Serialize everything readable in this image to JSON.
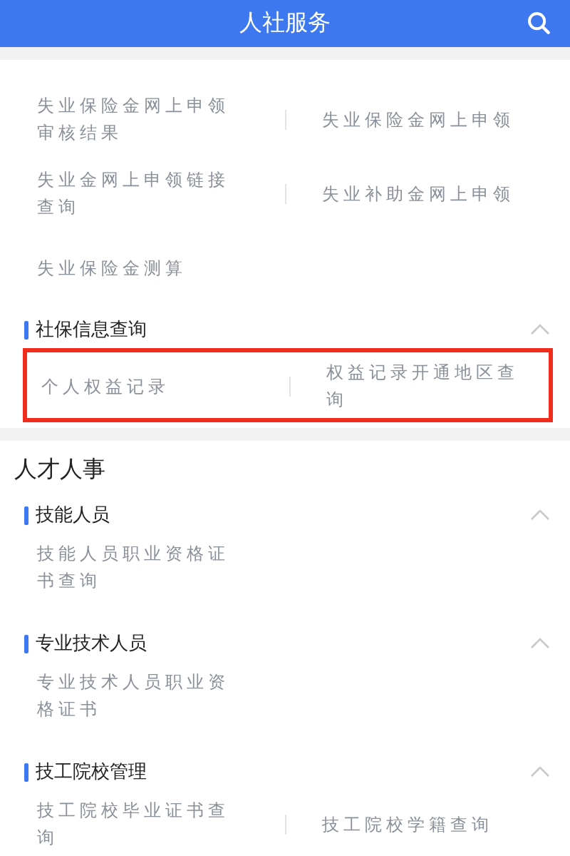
{
  "header": {
    "title": "人社服务"
  },
  "lead_items": [
    "失业保险金网上申领审核结果",
    "失业保险金网上申领",
    "失业金网上申领链接查询",
    "失业补助金网上申领",
    "失业保险金测算"
  ],
  "lead_sections": [
    {
      "title": "社保信息查询",
      "expanded": true,
      "highlighted": true,
      "items": [
        "个人权益记录",
        "权益记录开通地区查询"
      ]
    }
  ],
  "category": {
    "title": "人才人事",
    "sections": [
      {
        "title": "技能人员",
        "expanded": true,
        "highlighted": false,
        "items": [
          "技能人员职业资格证书查询"
        ]
      },
      {
        "title": "专业技术人员",
        "expanded": true,
        "highlighted": false,
        "items": [
          "专业技术人员职业资格证书"
        ]
      },
      {
        "title": "技工院校管理",
        "expanded": true,
        "highlighted": false,
        "items": [
          "技工院校毕业证书查询",
          "技工院校学籍查询"
        ]
      }
    ]
  }
}
